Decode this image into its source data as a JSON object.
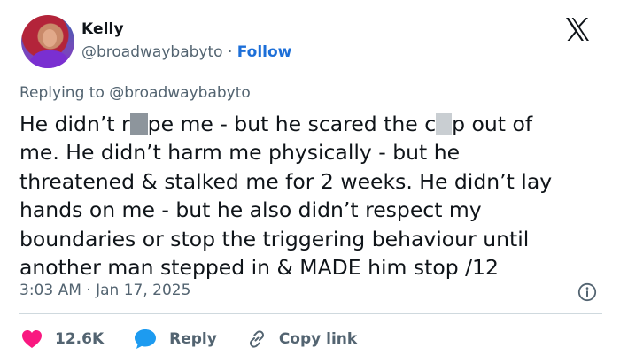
{
  "author": {
    "name": "Kelly",
    "handle": "@broadwaybabyto",
    "separator": "·",
    "follow_label": "Follow"
  },
  "replying_to": {
    "label": "Replying to",
    "handle": "@broadwaybabyto"
  },
  "tweet": {
    "line1_a": "He didn’t r",
    "line1_b": "pe me - but he scared the c",
    "line1_c": "p out of",
    "line2": "me. He didn’t harm me physically - but he",
    "line3": "threatened & stalked me for 2 weeks. He didn’t lay",
    "line4": "hands on me - but he also didn’t respect my",
    "line5": "boundaries or stop the triggering behaviour until",
    "line6": "another man stepped in & MADE him stop /12"
  },
  "meta": {
    "time": "3:03 AM",
    "separator": "·",
    "date": "Jan 17, 2025"
  },
  "actions": {
    "likes": "12.6K",
    "reply_label": "Reply",
    "copy_link_label": "Copy link"
  },
  "colors": {
    "like": "#f91880",
    "reply": "#1d9bf0",
    "link": "#1d6fd8",
    "muted": "#536471"
  },
  "icons": {
    "platform": "x-logo-icon",
    "info": "info-icon",
    "like": "heart-icon",
    "reply": "speech-bubble-icon",
    "copy": "link-icon"
  }
}
